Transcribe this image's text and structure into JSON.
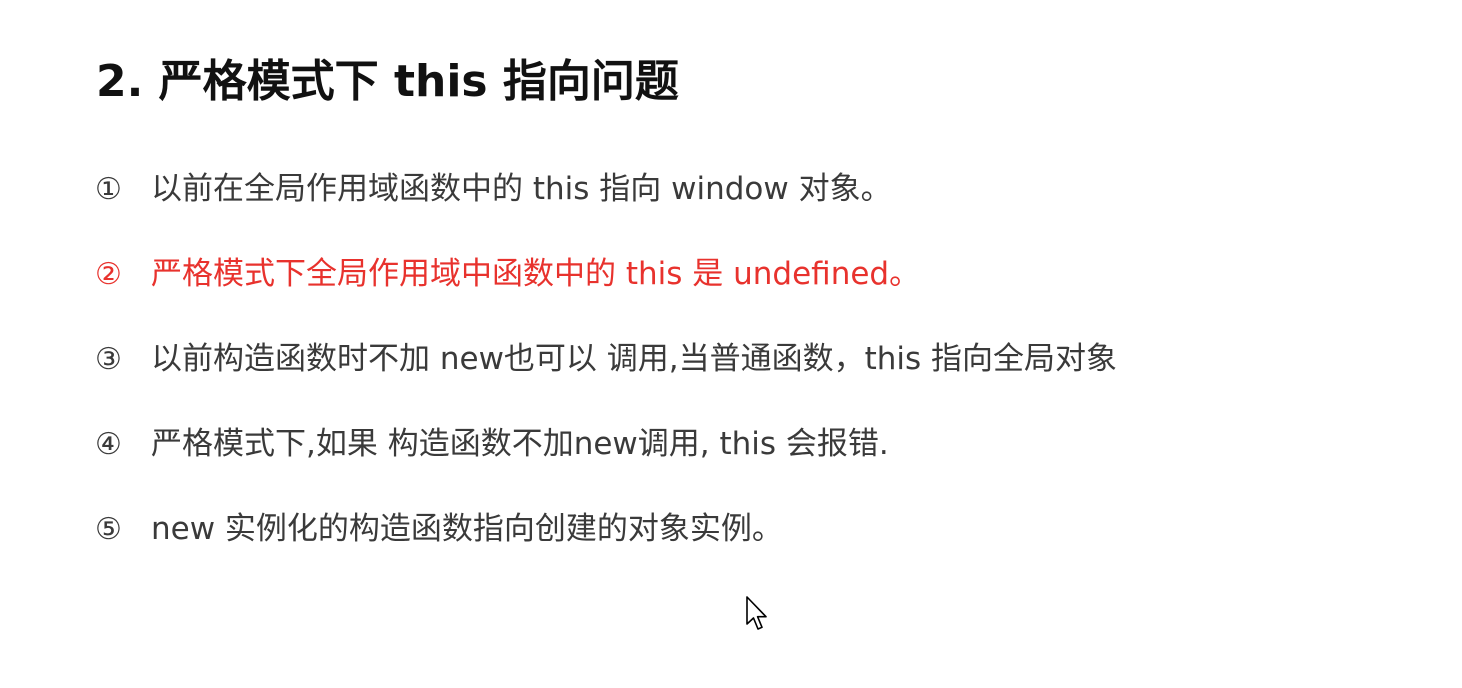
{
  "slide": {
    "title": "2. 严格模式下 this 指向问题",
    "points": [
      {
        "marker": "①",
        "text": "以前在全局作用域函数中的 this 指向 window 对象。",
        "highlight": false
      },
      {
        "marker": "②",
        "text": "严格模式下全局作用域中函数中的 this 是 undefined。",
        "highlight": true
      },
      {
        "marker": "③",
        "text": "以前构造函数时不加 new也可以 调用,当普通函数，this 指向全局对象",
        "highlight": false
      },
      {
        "marker": "④",
        "text": "严格模式下,如果 构造函数不加new调用, this 会报错.",
        "highlight": false
      },
      {
        "marker": "⑤",
        "text": "new 实例化的构造函数指向创建的对象实例。",
        "highlight": false
      }
    ],
    "highlight_color": "#e8322d",
    "text_color": "#3a3a3a",
    "title_color": "#111111"
  },
  "cursor": {
    "icon": "mouse-pointer-icon"
  }
}
